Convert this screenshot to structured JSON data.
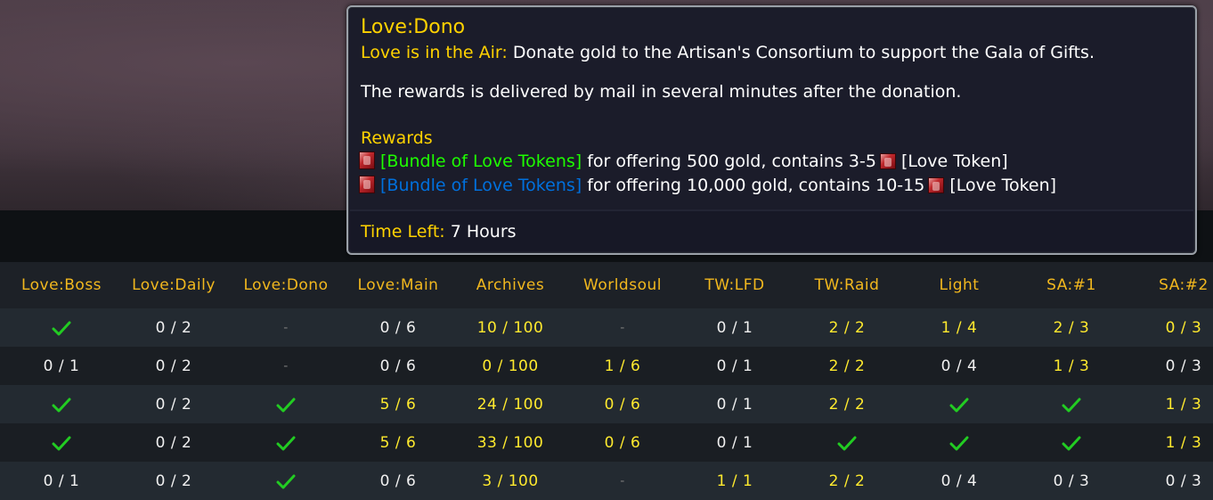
{
  "tooltip": {
    "title": "Love:Dono",
    "event_label": "Love is in the Air:",
    "event_desc": "Donate gold to the Artisan's Consortium to support the Gala of Gifts.",
    "note": "The rewards is delivered by mail in several minutes after the donation.",
    "rewards_heading": "Rewards",
    "rewards": [
      {
        "item": "[Bundle of Love Tokens]",
        "quality": "uncommon",
        "text": "for offering 500 gold, contains 3-5",
        "token": "[Love Token]"
      },
      {
        "item": "[Bundle of Love Tokens]",
        "quality": "rare",
        "text": "for offering 10,000 gold, contains 10-15",
        "token": "[Love Token]"
      }
    ],
    "time_label": "Time Left:",
    "time_value": "7 Hours",
    "icons": [
      "bundle-of-love-tokens-icon",
      "love-token-icon"
    ],
    "colors": {
      "title": "#ffd200",
      "uncommon": "#1eff00",
      "rare": "#0070dd"
    }
  },
  "columns": [
    "Love:Boss",
    "Love:Daily",
    "Love:Dono",
    "Love:Main",
    "Archives",
    "Worldsoul",
    "TW:LFD",
    "TW:Raid",
    "Light",
    "SA:#1",
    "SA:#2"
  ],
  "rows": [
    [
      {
        "t": "check"
      },
      {
        "t": "0 / 2",
        "c": "w"
      },
      {
        "t": "-",
        "c": "d"
      },
      {
        "t": "0 / 6",
        "c": "w"
      },
      {
        "t": "10 / 100",
        "c": "y"
      },
      {
        "t": "-",
        "c": "d"
      },
      {
        "t": "0 / 1",
        "c": "w"
      },
      {
        "t": "2 / 2",
        "c": "y"
      },
      {
        "t": "1 / 4",
        "c": "y"
      },
      {
        "t": "2 / 3",
        "c": "y"
      },
      {
        "t": "0 / 3",
        "c": "y"
      }
    ],
    [
      {
        "t": "0 / 1",
        "c": "w"
      },
      {
        "t": "0 / 2",
        "c": "w"
      },
      {
        "t": "-",
        "c": "d"
      },
      {
        "t": "0 / 6",
        "c": "w"
      },
      {
        "t": "0 / 100",
        "c": "y"
      },
      {
        "t": "1 / 6",
        "c": "y"
      },
      {
        "t": "0 / 1",
        "c": "w"
      },
      {
        "t": "2 / 2",
        "c": "y"
      },
      {
        "t": "0 / 4",
        "c": "w"
      },
      {
        "t": "1 / 3",
        "c": "y"
      },
      {
        "t": "0 / 3",
        "c": "w"
      }
    ],
    [
      {
        "t": "check"
      },
      {
        "t": "0 / 2",
        "c": "w"
      },
      {
        "t": "check"
      },
      {
        "t": "5 / 6",
        "c": "y"
      },
      {
        "t": "24 / 100",
        "c": "y"
      },
      {
        "t": "0 / 6",
        "c": "y"
      },
      {
        "t": "0 / 1",
        "c": "w"
      },
      {
        "t": "2 / 2",
        "c": "y"
      },
      {
        "t": "check"
      },
      {
        "t": "check"
      },
      {
        "t": "1 / 3",
        "c": "y"
      }
    ],
    [
      {
        "t": "check"
      },
      {
        "t": "0 / 2",
        "c": "w"
      },
      {
        "t": "check"
      },
      {
        "t": "5 / 6",
        "c": "y"
      },
      {
        "t": "33 / 100",
        "c": "y"
      },
      {
        "t": "0 / 6",
        "c": "y"
      },
      {
        "t": "0 / 1",
        "c": "w"
      },
      {
        "t": "check"
      },
      {
        "t": "check"
      },
      {
        "t": "check"
      },
      {
        "t": "1 / 3",
        "c": "y"
      }
    ],
    [
      {
        "t": "0 / 1",
        "c": "w"
      },
      {
        "t": "0 / 2",
        "c": "w"
      },
      {
        "t": "check"
      },
      {
        "t": "0 / 6",
        "c": "w"
      },
      {
        "t": "3 / 100",
        "c": "y"
      },
      {
        "t": "-",
        "c": "d"
      },
      {
        "t": "1 / 1",
        "c": "y"
      },
      {
        "t": "2 / 2",
        "c": "y"
      },
      {
        "t": "0 / 4",
        "c": "w"
      },
      {
        "t": "0 / 3",
        "c": "w"
      },
      {
        "t": "0 / 3",
        "c": "w"
      }
    ]
  ],
  "check_color": "#22cc22"
}
